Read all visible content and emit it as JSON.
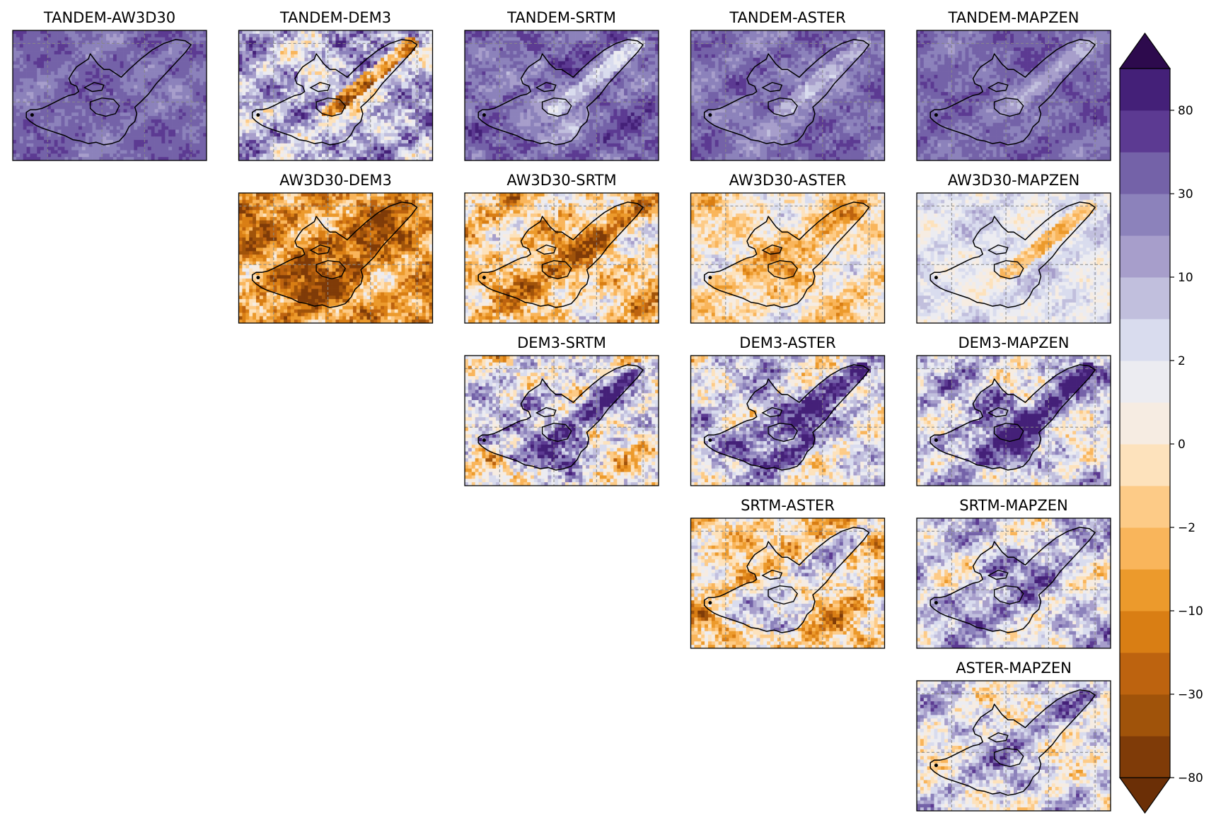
{
  "chart_data": {
    "type": "heatmap",
    "description_of_layout": "upper-triangular matrix of pairwise DEM difference maps",
    "colormap": "PuOr",
    "colorbar": {
      "boundaries": [
        -80,
        -50,
        -30,
        -20,
        -10,
        -5,
        -2,
        -1,
        0,
        1,
        2,
        5,
        10,
        20,
        30,
        50,
        80
      ],
      "tick_values": [
        80,
        30,
        10,
        2,
        0,
        -2,
        -10,
        -30,
        -80
      ],
      "tick_labels": [
        "80",
        "30",
        "10",
        "2",
        "0",
        "−2",
        "−10",
        "−30",
        "−80"
      ],
      "colors": [
        "#7f3b08",
        "#a0530a",
        "#bd630f",
        "#d97e14",
        "#ec9a2c",
        "#f9b55b",
        "#fdcb87",
        "#fde2bc",
        "#f6ece2",
        "#ececf1",
        "#d9dcee",
        "#c1bfdd",
        "#a79ecb",
        "#8c82bb",
        "#7462a8",
        "#5c3a92",
        "#442078"
      ],
      "extend": "both",
      "ext_max_color": "#2d0a4d",
      "ext_min_color": "#6b2f06"
    },
    "panels": [
      {
        "title": "TANDEM-AW3D30",
        "row": 0,
        "col": 0,
        "base": 0.84,
        "var": 0.08,
        "inside": 0.84,
        "ridge": 0.8
      },
      {
        "title": "TANDEM-DEM3",
        "row": 0,
        "col": 1,
        "base": 0.7,
        "var": 0.3,
        "inside": 0.62,
        "ridge": 0.22
      },
      {
        "title": "TANDEM-SRTM",
        "row": 0,
        "col": 2,
        "base": 0.84,
        "var": 0.12,
        "inside": 0.78,
        "ridge": 0.66
      },
      {
        "title": "TANDEM-ASTER",
        "row": 0,
        "col": 3,
        "base": 0.83,
        "var": 0.1,
        "inside": 0.8,
        "ridge": 0.7
      },
      {
        "title": "TANDEM-MAPZEN",
        "row": 0,
        "col": 4,
        "base": 0.84,
        "var": 0.08,
        "inside": 0.82,
        "ridge": 0.76
      },
      {
        "title": "AW3D30-DEM3",
        "row": 1,
        "col": 1,
        "base": 0.26,
        "var": 0.28,
        "inside": 0.16,
        "ridge": 0.14
      },
      {
        "title": "AW3D30-SRTM",
        "row": 1,
        "col": 2,
        "base": 0.4,
        "var": 0.3,
        "inside": 0.3,
        "ridge": 0.26
      },
      {
        "title": "AW3D30-ASTER",
        "row": 1,
        "col": 3,
        "base": 0.45,
        "var": 0.22,
        "inside": 0.4,
        "ridge": 0.3
      },
      {
        "title": "AW3D30-MAPZEN",
        "row": 1,
        "col": 4,
        "base": 0.58,
        "var": 0.14,
        "inside": 0.58,
        "ridge": 0.38
      },
      {
        "title": "DEM3-SRTM",
        "row": 2,
        "col": 2,
        "base": 0.55,
        "var": 0.34,
        "inside": 0.76,
        "ridge": 0.86
      },
      {
        "title": "DEM3-ASTER",
        "row": 2,
        "col": 3,
        "base": 0.6,
        "var": 0.3,
        "inside": 0.82,
        "ridge": 0.95
      },
      {
        "title": "DEM3-MAPZEN",
        "row": 2,
        "col": 4,
        "base": 0.62,
        "var": 0.3,
        "inside": 0.82,
        "ridge": 0.95
      },
      {
        "title": "SRTM-ASTER",
        "row": 3,
        "col": 3,
        "base": 0.4,
        "var": 0.3,
        "inside": 0.55,
        "ridge": 0.58
      },
      {
        "title": "SRTM-MAPZEN",
        "row": 3,
        "col": 4,
        "base": 0.62,
        "var": 0.28,
        "inside": 0.72,
        "ridge": 0.7
      },
      {
        "title": "ASTER-MAPZEN",
        "row": 4,
        "col": 4,
        "base": 0.58,
        "var": 0.28,
        "inside": 0.64,
        "ridge": 0.66
      }
    ]
  }
}
